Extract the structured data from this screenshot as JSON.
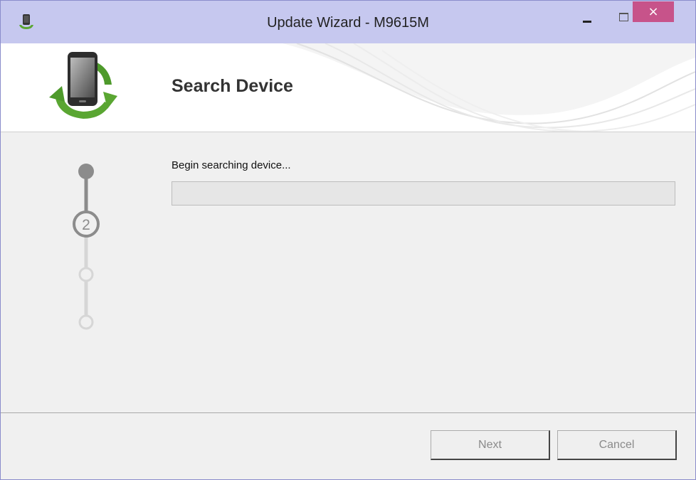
{
  "window": {
    "title": "Update Wizard - M9615M",
    "close_glyph": "×",
    "minimize_icon": "minimize-icon",
    "maximize_icon": "maximize-icon",
    "app_icon": "phone-update-icon"
  },
  "header": {
    "heading": "Search Device",
    "logo_icon": "device-sync-icon"
  },
  "steps": {
    "current_step_number": "2",
    "total_steps": 4,
    "current_step": 2
  },
  "main": {
    "status_text": "Begin searching device...",
    "progress_fraction": 0
  },
  "footer": {
    "next_label": "Next",
    "cancel_label": "Cancel"
  },
  "colors": {
    "titlebar": "#c6c8ef",
    "close_button": "#c7538a",
    "step_active": "#8c8c8c",
    "step_inactive": "#d6d6d6",
    "logo_green": "#5aa632"
  }
}
